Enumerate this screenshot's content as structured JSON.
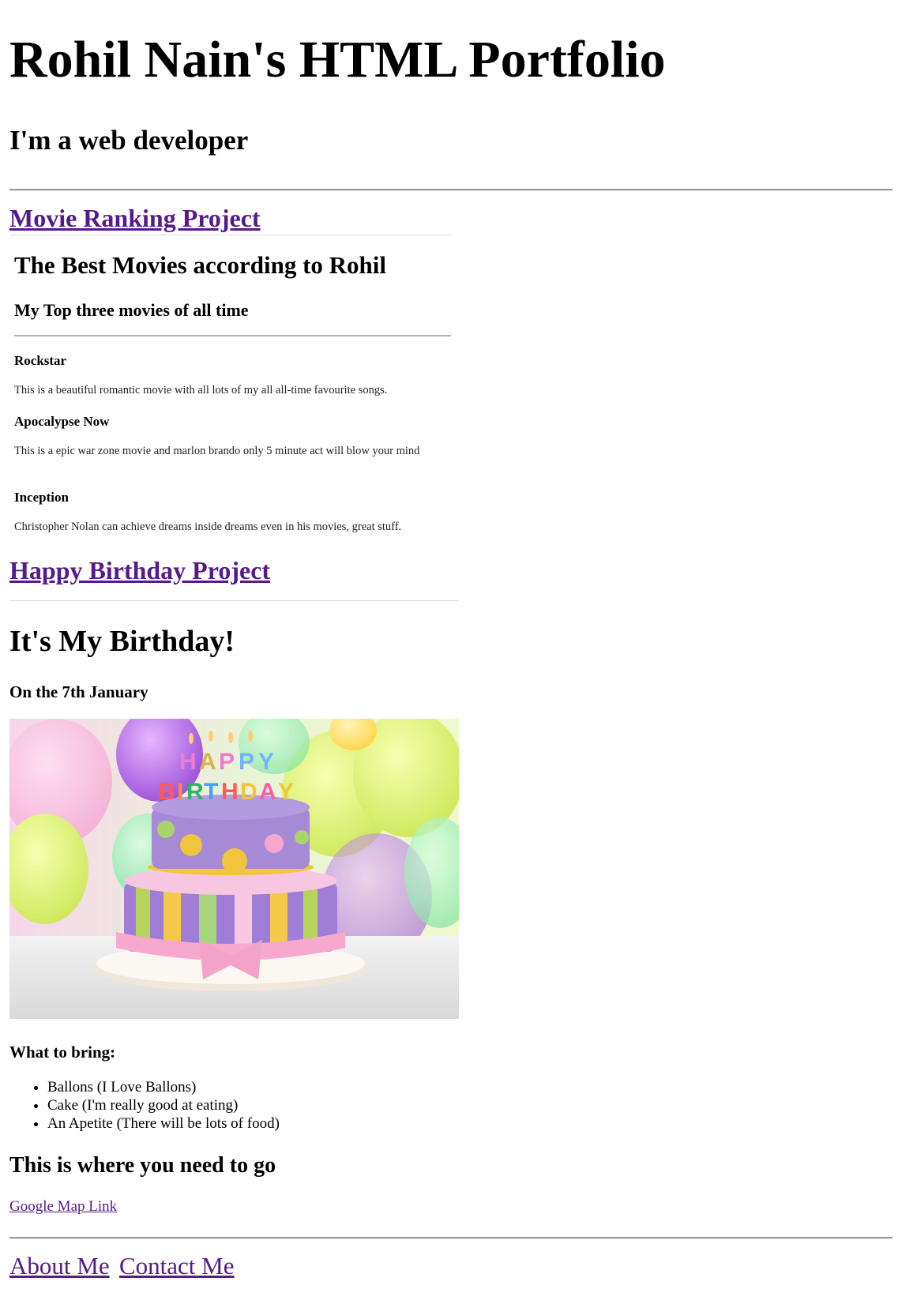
{
  "header": {
    "title": "Rohil Nain's HTML Portfolio",
    "subtitle": "I'm a web developer"
  },
  "movie_project": {
    "link_label": "Movie Ranking Project",
    "heading": "The Best Movies according to Rohil",
    "subheading": "My Top three movies of all time",
    "movies": [
      {
        "title": "Rockstar",
        "description": "This is a beautiful romantic movie with all lots of my all all-time favourite songs."
      },
      {
        "title": "Apocalypse Now",
        "description": "This is a epic war zone movie and marlon brando only 5 minute act will blow your mind"
      },
      {
        "title": "Inception",
        "description": "Christopher Nolan can achieve dreams inside dreams even in his movies, great stuff."
      }
    ]
  },
  "birthday_project": {
    "link_label": "Happy Birthday Project",
    "heading": "It's My Birthday!",
    "date": "On the 7th January",
    "image_alt": "HAPPY BIRTHDAY",
    "bring_heading": "What to bring:",
    "bring_items": [
      "Ballons (I Love Ballons)",
      "Cake (I'm really good at eating)",
      "An Apetite (There will be lots of food)"
    ],
    "go_heading": "This is where you need to go",
    "map_link": "Google Map Link"
  },
  "footer": {
    "about_label": "About Me",
    "contact_label": "Contact Me"
  }
}
